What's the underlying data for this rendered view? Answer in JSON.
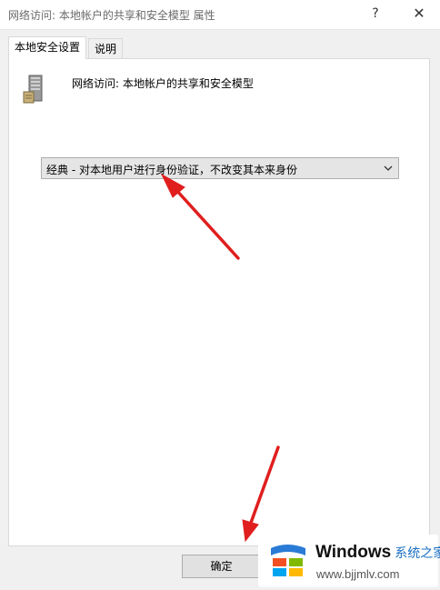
{
  "window": {
    "title": "网络访问: 本地帐户的共享和安全模型 属性",
    "help_button": "?",
    "close_button": "✕"
  },
  "tabs": [
    {
      "label": "本地安全设置",
      "active": true
    },
    {
      "label": "说明",
      "active": false
    }
  ],
  "policy": {
    "icon": "server-computer-icon",
    "name": "网络访问: 本地帐户的共享和安全模型"
  },
  "dropdown": {
    "selected": "经典 - 对本地用户进行身份验证，不改变其本来身份"
  },
  "buttons": {
    "ok": "确定"
  },
  "annotation_color": "#e01e1e",
  "watermark": {
    "brand": "Windows",
    "brand_cn": "系统之家",
    "url": "www.bjjmlv.com"
  }
}
